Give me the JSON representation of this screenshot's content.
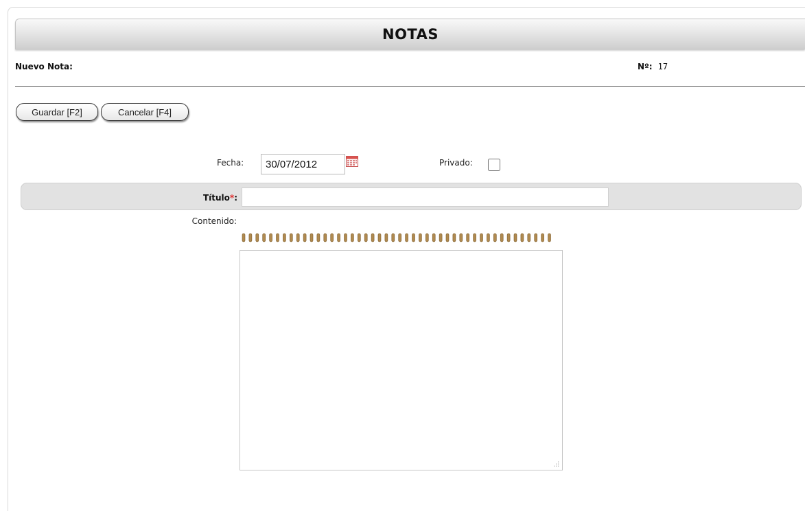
{
  "header": {
    "title": "NOTAS"
  },
  "info": {
    "new_label": "Nuevo Nota:",
    "number_label": "Nº:",
    "number_value": "17"
  },
  "toolbar": {
    "save_label": "Guardar [F2]",
    "cancel_label": "Cancelar [F4]"
  },
  "form": {
    "date_label": "Fecha:",
    "date_value": "30/07/2012",
    "private_label": "Privado:",
    "private_checked": false,
    "title_label": "Título",
    "title_required_mark": "*",
    "title_colon": ":",
    "title_value": "",
    "content_label": "Contenido:",
    "content_value": ""
  },
  "icons": {
    "calendar": "calendar-icon",
    "spiral": "notebook-spiral-icon",
    "grip": "resize-grip-icon"
  },
  "colors": {
    "required": "#e03030",
    "row_bg": "#e2e2e2",
    "spiral": "#b08a50"
  }
}
